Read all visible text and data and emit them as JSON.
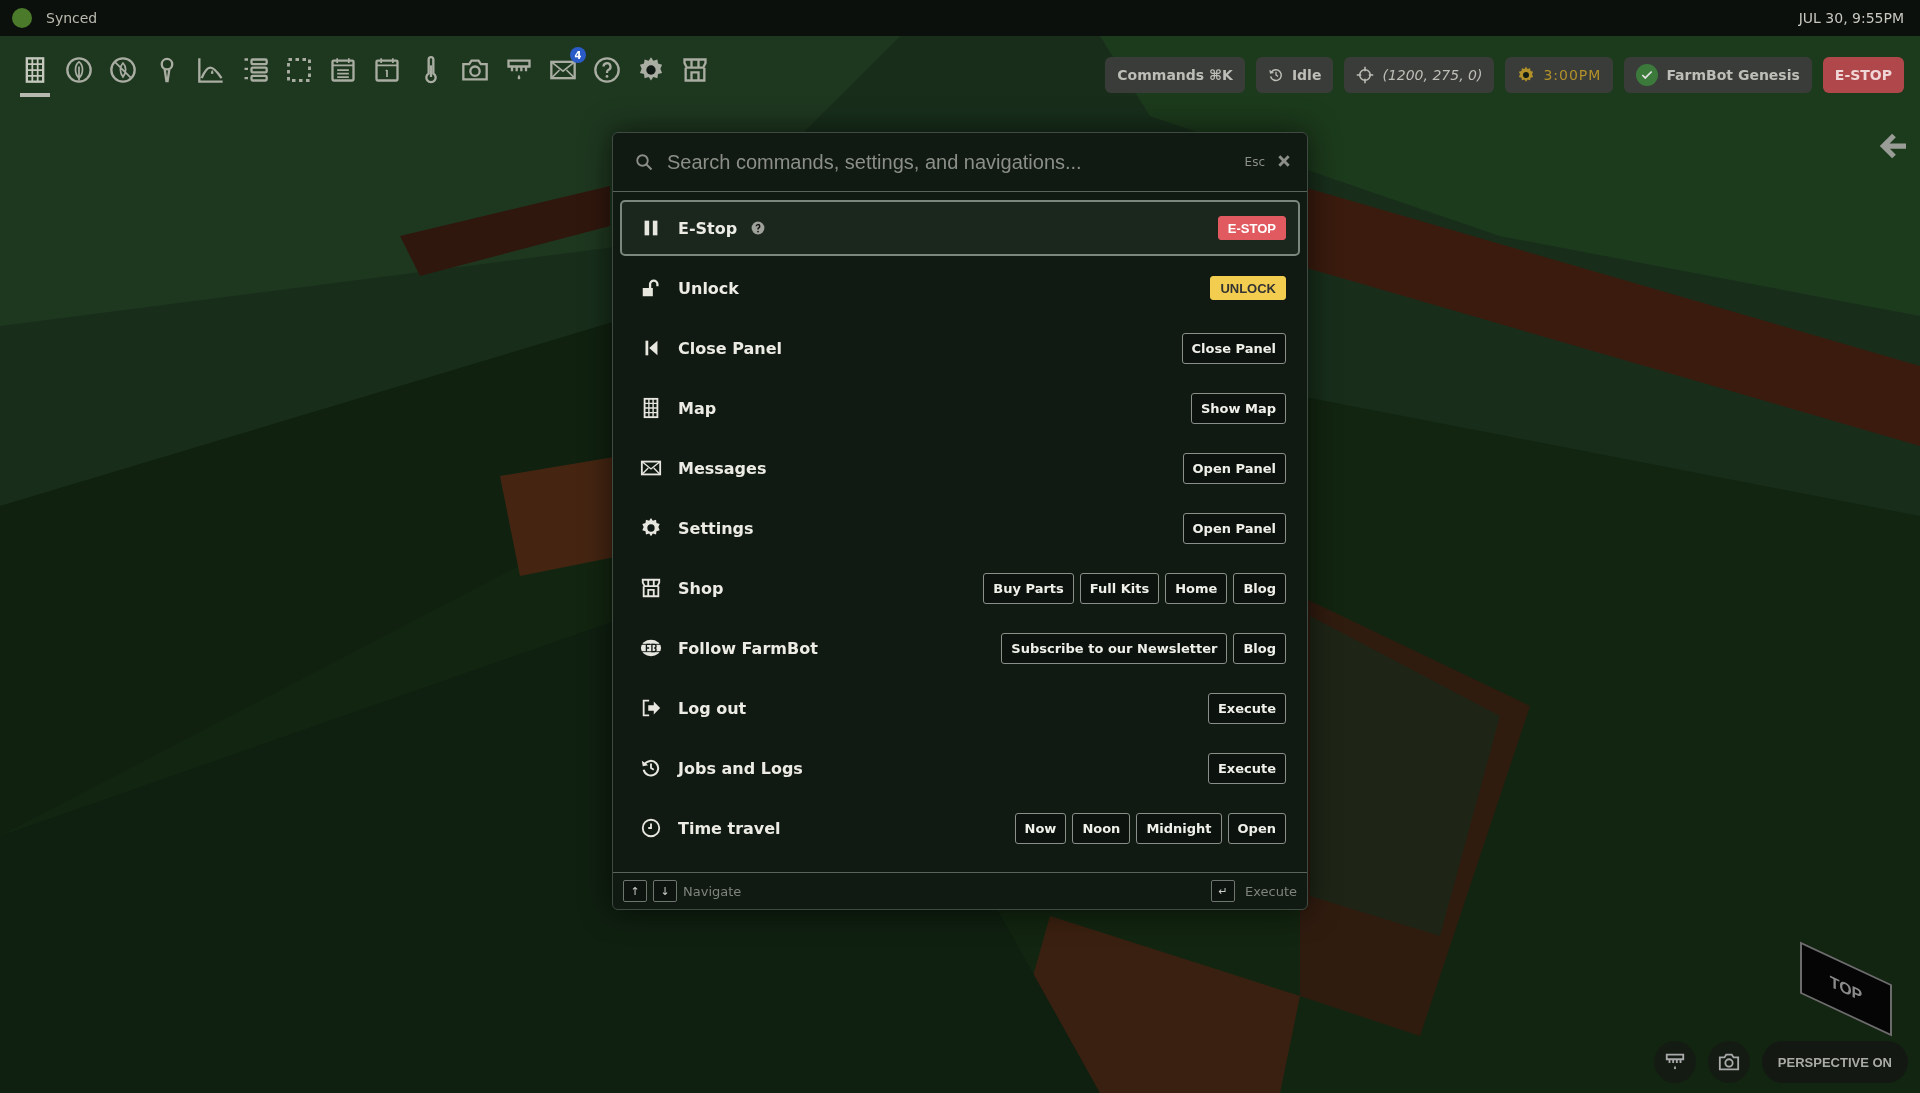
{
  "top_bar": {
    "sync": "Synced",
    "date": "JUL 30, 9:55PM"
  },
  "toolbar": {
    "items": [
      {
        "kind": "grid",
        "selected": true
      },
      {
        "kind": "leaf",
        "selected": false
      },
      {
        "kind": "weed",
        "selected": false
      },
      {
        "kind": "pin",
        "selected": false
      },
      {
        "kind": "curve",
        "selected": false
      },
      {
        "kind": "list",
        "selected": false
      },
      {
        "kind": "zone",
        "selected": false
      },
      {
        "kind": "calendar",
        "selected": false
      },
      {
        "kind": "day",
        "selected": false
      },
      {
        "kind": "thermometer",
        "selected": false
      },
      {
        "kind": "camera",
        "selected": false
      },
      {
        "kind": "tool",
        "selected": false
      },
      {
        "kind": "mail",
        "selected": false,
        "badge": "4"
      },
      {
        "kind": "help",
        "selected": false
      },
      {
        "kind": "gear",
        "selected": false
      },
      {
        "kind": "shop",
        "selected": false
      }
    ]
  },
  "status_chips": {
    "commands": "Commands ⌘K",
    "state": "Idle",
    "position": "(1200, 275, 0)",
    "time": "3:00PM",
    "device": "FarmBot Genesis",
    "estop": "E-STOP"
  },
  "palette": {
    "placeholder": "Search commands, settings, and navigations...",
    "esc": "Esc",
    "rows": [
      {
        "label": "E-Stop",
        "kind": "pause",
        "help": true,
        "selected": true,
        "actions": [
          {
            "label": "E-STOP",
            "kind": "danger"
          }
        ]
      },
      {
        "label": "Unlock",
        "kind": "unlock",
        "help": false,
        "selected": false,
        "actions": [
          {
            "label": "UNLOCK",
            "kind": "warning"
          }
        ]
      },
      {
        "label": "Close Panel",
        "kind": "close-panel",
        "help": false,
        "selected": false,
        "actions": [
          {
            "label": "Close Panel",
            "kind": "outline"
          }
        ]
      },
      {
        "label": "Map",
        "kind": "grid",
        "help": false,
        "selected": false,
        "actions": [
          {
            "label": "Show Map",
            "kind": "outline"
          }
        ]
      },
      {
        "label": "Messages",
        "kind": "mail",
        "help": false,
        "selected": false,
        "actions": [
          {
            "label": "Open Panel",
            "kind": "outline"
          }
        ]
      },
      {
        "label": "Settings",
        "kind": "gear",
        "help": false,
        "selected": false,
        "actions": [
          {
            "label": "Open Panel",
            "kind": "outline"
          }
        ]
      },
      {
        "label": "Shop",
        "kind": "shop",
        "help": false,
        "selected": false,
        "actions": [
          {
            "label": "Buy Parts",
            "kind": "outline"
          },
          {
            "label": "Full Kits",
            "kind": "outline"
          },
          {
            "label": "Home",
            "kind": "outline"
          },
          {
            "label": "Blog",
            "kind": "outline"
          }
        ]
      },
      {
        "label": "Follow FarmBot",
        "kind": "logo",
        "help": false,
        "selected": false,
        "actions": [
          {
            "label": "Subscribe to our Newsletter",
            "kind": "outline"
          },
          {
            "label": "Blog",
            "kind": "outline"
          }
        ]
      },
      {
        "label": "Log out",
        "kind": "logout",
        "help": false,
        "selected": false,
        "actions": [
          {
            "label": "Execute",
            "kind": "outline"
          }
        ]
      },
      {
        "label": "Jobs and Logs",
        "kind": "history",
        "help": false,
        "selected": false,
        "actions": [
          {
            "label": "Execute",
            "kind": "outline"
          }
        ]
      },
      {
        "label": "Time travel",
        "kind": "clock",
        "help": false,
        "selected": false,
        "actions": [
          {
            "label": "Now",
            "kind": "outline"
          },
          {
            "label": "Noon",
            "kind": "outline"
          },
          {
            "label": "Midnight",
            "kind": "outline"
          },
          {
            "label": "Open",
            "kind": "outline"
          }
        ]
      }
    ],
    "footer": {
      "up": "↑",
      "down": "↓",
      "navigate": "Navigate",
      "enter": "↵",
      "execute": "Execute"
    }
  },
  "view_controls": {
    "cube": "TOP",
    "perspective": "PERSPECTIVE ON"
  }
}
